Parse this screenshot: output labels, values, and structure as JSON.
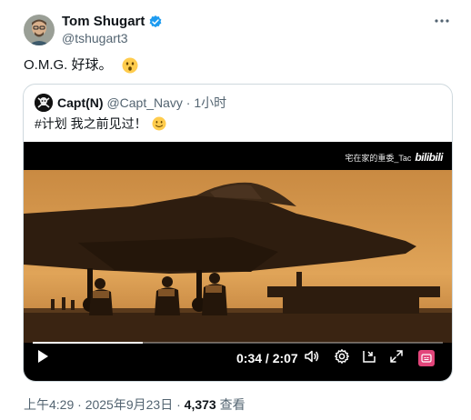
{
  "author": {
    "name": "Tom Shugart",
    "handle": "@tshugart3",
    "verified": true
  },
  "tweet": {
    "text": "O.M.G. 好球。",
    "emoji": "astonished-face"
  },
  "quote": {
    "name": "Capt(N)",
    "handle": "@Capt_Navy",
    "separator": "·",
    "time": "1小时",
    "text": "#计划 我之前见过！",
    "emoji": "slightly-smiling-face"
  },
  "video": {
    "watermark_text": "宅在家的重委_Tac",
    "watermark_logo": "bilibili",
    "current_time": "0:34",
    "duration": "2:07",
    "time_display": "0:34 / 2:07",
    "progress": 0.268
  },
  "footer": {
    "time": "上午4:29",
    "sep1": "·",
    "date": "2025年9月23日",
    "sep2": "·",
    "views": "4,373",
    "views_label": "查看"
  },
  "colors": {
    "verified_blue": "#1d9bf0",
    "text_primary": "#0f1419",
    "text_secondary": "#536471",
    "border": "#cfd9de",
    "sky": "#d99a4b"
  }
}
